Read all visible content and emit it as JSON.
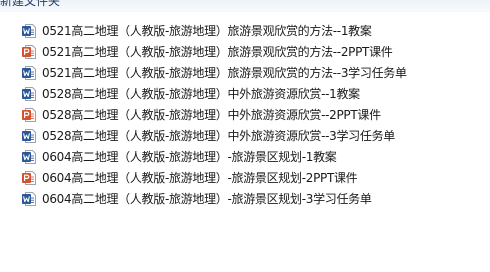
{
  "window": {
    "header_partial_text": "新建文件夹"
  },
  "files": [
    {
      "name": "0521高二地理（人教版-旅游地理）旅游景观欣赏的方法--1教案",
      "icon": "word-doc-icon",
      "icon_color": "#2b5797"
    },
    {
      "name": "0521高二地理（人教版-旅游地理）旅游景观欣赏的方法--2PPT课件",
      "icon": "ppt-icon",
      "icon_color": "#d35230"
    },
    {
      "name": "0521高二地理（人教版-旅游地理）旅游景观欣赏的方法--3学习任务单",
      "icon": "word-doc-icon",
      "icon_color": "#2b5797"
    },
    {
      "name": "0528高二地理（人教版-旅游地理）中外旅游资源欣赏--1教案",
      "icon": "word-doc-icon",
      "icon_color": "#2b5797"
    },
    {
      "name": "0528高二地理（人教版-旅游地理）中外旅游资源欣赏--2PPT课件",
      "icon": "ppt-icon",
      "icon_color": "#d35230"
    },
    {
      "name": "0528高二地理（人教版-旅游地理）中外旅游资源欣赏--3学习任务单",
      "icon": "word-doc-icon",
      "icon_color": "#2b5797"
    },
    {
      "name": "0604高二地理（人教版-旅游地理）-旅游景区规划-1教案",
      "icon": "word-doc-icon",
      "icon_color": "#2b5797"
    },
    {
      "name": "0604高二地理（人教版-旅游地理）-旅游景区规划-2PPT课件",
      "icon": "ppt-icon",
      "icon_color": "#d35230"
    },
    {
      "name": "0604高二地理（人教版-旅游地理）-旅游景区规划-3学习任务单",
      "icon": "word-doc-icon",
      "icon_color": "#2b5797"
    }
  ]
}
